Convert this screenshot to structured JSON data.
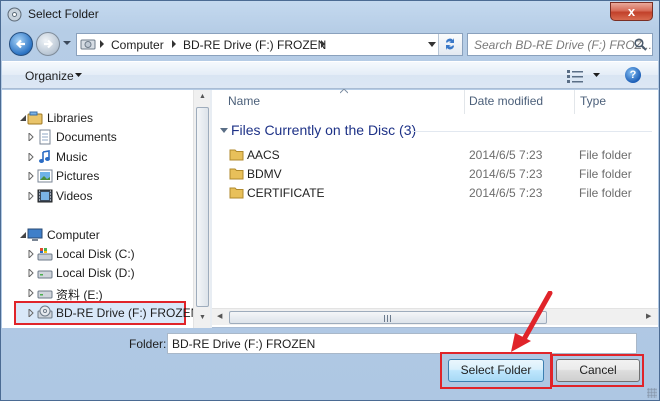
{
  "window": {
    "title": "Select Folder",
    "close_glyph": "x"
  },
  "nav": {
    "address": [
      "Computer",
      "BD-RE Drive (F:) FROZEN"
    ],
    "search_placeholder": "Search BD-RE Drive (F:) FROZ..."
  },
  "toolbar": {
    "organize_label": "Organize"
  },
  "tree": {
    "libraries": {
      "label": "Libraries",
      "items": [
        "Documents",
        "Music",
        "Pictures",
        "Videos"
      ]
    },
    "computer": {
      "label": "Computer",
      "items": [
        "Local Disk (C:)",
        "Local Disk (D:)",
        "资料 (E:)",
        "BD-RE Drive (F:) FROZEN"
      ]
    }
  },
  "files": {
    "columns": {
      "name": "Name",
      "date": "Date modified",
      "type": "Type"
    },
    "group_title": "Files Currently on the Disc (3)",
    "rows": [
      {
        "name": "AACS",
        "date": "2014/6/5 7:23",
        "type": "File folder"
      },
      {
        "name": "BDMV",
        "date": "2014/6/5 7:23",
        "type": "File folder"
      },
      {
        "name": "CERTIFICATE",
        "date": "2014/6/5 7:23",
        "type": "File folder"
      }
    ]
  },
  "footer": {
    "folder_label": "Folder:",
    "folder_value": "BD-RE Drive (F:) FROZEN",
    "select_button": "Select Folder",
    "cancel_button": "Cancel"
  },
  "colors": {
    "highlight": "#e0242a",
    "group_title": "#1e3287"
  }
}
